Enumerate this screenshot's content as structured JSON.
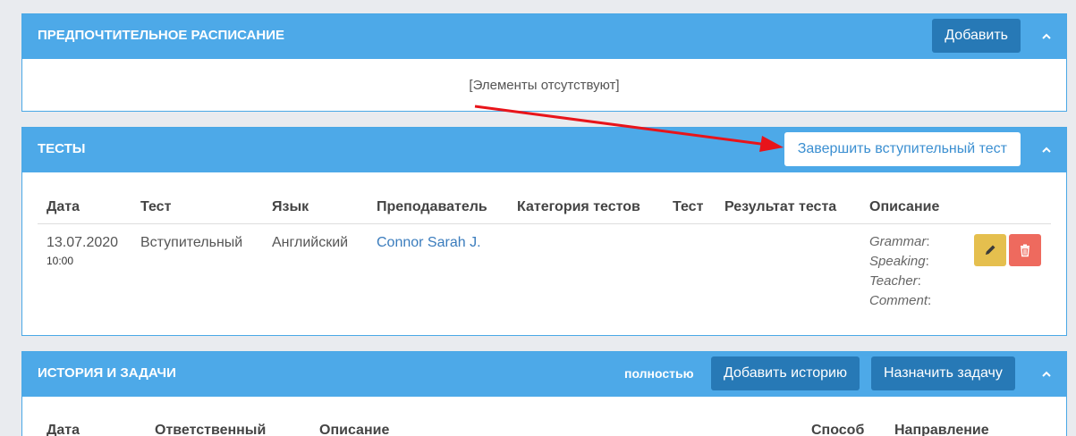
{
  "preferred_schedule": {
    "title": "ПРЕДПОЧТИТЕЛЬНОЕ РАСПИСАНИЕ",
    "add_label": "Добавить",
    "empty_text": "[Элементы отсутствуют]"
  },
  "tests": {
    "title": "ТЕСТЫ",
    "finish_label": "Завершить вступительный тест",
    "columns": [
      "Дата",
      "Тест",
      "Язык",
      "Преподаватель",
      "Категория тестов",
      "Тест",
      "Результат теста",
      "Описание"
    ],
    "rows": [
      {
        "date": "13.07.2020",
        "time": "10:00",
        "test": "Вступительный",
        "language": "Английский",
        "teacher": "Connor Sarah J.",
        "category": "",
        "test2": "",
        "result": "",
        "description": [
          "Grammar",
          "Speaking",
          "Teacher",
          "Comment"
        ]
      }
    ]
  },
  "history": {
    "title": "ИСТОРИЯ И ЗАДАЧИ",
    "full_label": "полностью",
    "add_history_label": "Добавить историю",
    "assign_task_label": "Назначить задачу",
    "columns": [
      "Дата",
      "Ответственный",
      "Описание",
      "Способ",
      "Направление"
    ]
  },
  "colors": {
    "panel_header": "#4da9e8",
    "button_dark": "#2779b6",
    "edit_button": "#e5bf4e",
    "delete_button": "#ee6a5e",
    "annotation_arrow": "#e8141a"
  },
  "icons": [
    "chevron-up-icon",
    "pencil-icon",
    "trash-icon"
  ]
}
